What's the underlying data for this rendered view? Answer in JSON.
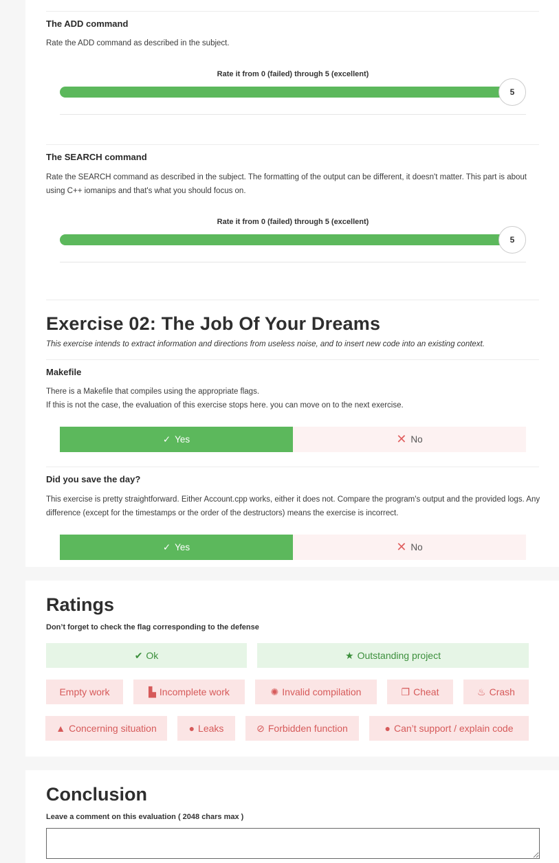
{
  "add": {
    "title": "The ADD command",
    "description": "Rate the ADD command as described in the subject.",
    "rate_label": "Rate it from 0 (failed) through 5 (excellent)",
    "value": "5"
  },
  "search": {
    "title": "The SEARCH command",
    "description": "Rate the SEARCH command as described in the subject. The formatting of the output can be different, it doesn't matter. This part is about using C++ iomanips and that's what you should focus on.",
    "rate_label": "Rate it from 0 (failed) through 5 (excellent)",
    "value": "5"
  },
  "exercise": {
    "title": "Exercise 02: The Job Of Your Dreams",
    "subtitle": "This exercise intends to extract information and directions from useless noise, and to insert new code into an existing context."
  },
  "makefile": {
    "title": "Makefile",
    "line1": "There is a Makefile that compiles using the appropriate flags.",
    "line2": "If this is not the case, the evaluation of this exercise stops here. you can move on to the next exercise.",
    "yes": "Yes",
    "no": "No"
  },
  "saveday": {
    "title": "Did you save the day?",
    "description": "This exercise is pretty straightforward. Either Account.cpp works, either it does not. Compare the program's output and the provided logs. Any difference (except for the timestamps or the order of the destructors) means the exercise is incorrect.",
    "yes": "Yes",
    "no": "No"
  },
  "ratings": {
    "title": "Ratings",
    "subtitle": "Don’t forget to check the flag corresponding to the defense",
    "flags": {
      "ok": "Ok",
      "outstanding": "Outstanding project",
      "empty": "Empty work",
      "incomplete": "Incomplete work",
      "invalid": "Invalid compilation",
      "cheat": "Cheat",
      "crash": "Crash",
      "concerning": "Concerning situation",
      "leaks": "Leaks",
      "forbidden": "Forbidden function",
      "cant_support": "Can’t support / explain code"
    }
  },
  "conclusion": {
    "title": "Conclusion",
    "label": "Leave a comment on this evaluation ( 2048 chars max )",
    "comment": ""
  },
  "colors": {
    "green": "#5cb85c",
    "red": "#d65a5a"
  }
}
